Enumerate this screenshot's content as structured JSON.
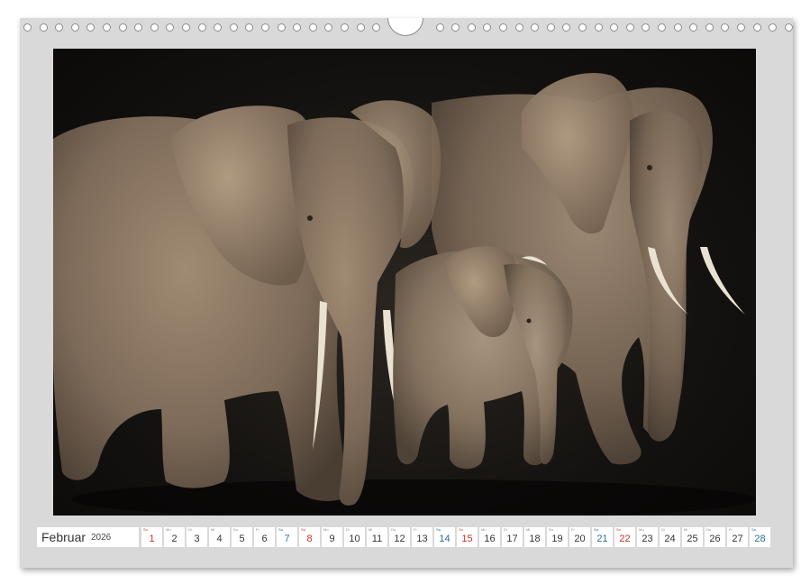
{
  "calendar": {
    "month": "Februar",
    "year": "2026",
    "weekday_colors": {
      "sunday": "#c8302a",
      "saturday": "#2a6f9c",
      "weekday": "#333333"
    },
    "days": [
      {
        "wd": "So",
        "n": "1",
        "kind": "sun"
      },
      {
        "wd": "Mo",
        "n": "2",
        "kind": "day"
      },
      {
        "wd": "Di",
        "n": "3",
        "kind": "day"
      },
      {
        "wd": "Mi",
        "n": "4",
        "kind": "day"
      },
      {
        "wd": "Do",
        "n": "5",
        "kind": "day"
      },
      {
        "wd": "Fr",
        "n": "6",
        "kind": "day"
      },
      {
        "wd": "Sa",
        "n": "7",
        "kind": "sat"
      },
      {
        "wd": "So",
        "n": "8",
        "kind": "sun"
      },
      {
        "wd": "Mo",
        "n": "9",
        "kind": "day"
      },
      {
        "wd": "Di",
        "n": "10",
        "kind": "day"
      },
      {
        "wd": "Mi",
        "n": "11",
        "kind": "day"
      },
      {
        "wd": "Do",
        "n": "12",
        "kind": "day"
      },
      {
        "wd": "Fr",
        "n": "13",
        "kind": "day"
      },
      {
        "wd": "Sa",
        "n": "14",
        "kind": "sat"
      },
      {
        "wd": "So",
        "n": "15",
        "kind": "sun"
      },
      {
        "wd": "Mo",
        "n": "16",
        "kind": "day"
      },
      {
        "wd": "Di",
        "n": "17",
        "kind": "day"
      },
      {
        "wd": "Mi",
        "n": "18",
        "kind": "day"
      },
      {
        "wd": "Do",
        "n": "19",
        "kind": "day"
      },
      {
        "wd": "Fr",
        "n": "20",
        "kind": "day"
      },
      {
        "wd": "Sa",
        "n": "21",
        "kind": "sat"
      },
      {
        "wd": "So",
        "n": "22",
        "kind": "sun"
      },
      {
        "wd": "Mo",
        "n": "23",
        "kind": "day"
      },
      {
        "wd": "Di",
        "n": "24",
        "kind": "day"
      },
      {
        "wd": "Mi",
        "n": "25",
        "kind": "day"
      },
      {
        "wd": "Do",
        "n": "26",
        "kind": "day"
      },
      {
        "wd": "Fr",
        "n": "27",
        "kind": "day"
      },
      {
        "wd": "Sa",
        "n": "28",
        "kind": "sat"
      }
    ]
  },
  "photo": {
    "subject": "elephant-family-photo",
    "colors": {
      "background": "#141210",
      "elephant_skin": "#8a7663",
      "tusk": "#e9e2d0"
    }
  }
}
